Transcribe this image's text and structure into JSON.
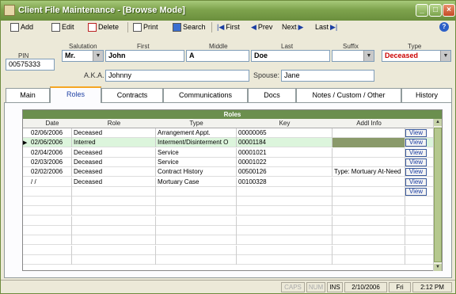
{
  "window": {
    "title": "Client File Maintenance - [Browse Mode]"
  },
  "toolbar": {
    "add": "Add",
    "edit": "Edit",
    "delete": "Delete",
    "print": "Print",
    "search": "Search",
    "first": "First",
    "prev": "Prev",
    "next": "Next",
    "last": "Last"
  },
  "client": {
    "pin_label": "PIN",
    "pin": "00575333",
    "salutation_label": "Salutation",
    "salutation": "Mr.",
    "first_label": "First",
    "first": "John",
    "middle_label": "Middle",
    "middle": "A",
    "last_label": "Last",
    "last": "Doe",
    "suffix_label": "Suffix",
    "suffix": "",
    "type_label": "Type",
    "type": "Deceased",
    "aka_label": "A.K.A.",
    "aka": "Johnny",
    "spouse_label": "Spouse:",
    "spouse": "Jane"
  },
  "tabs": [
    "Main",
    "Roles",
    "Contracts",
    "Communications",
    "Docs",
    "Notes / Custom / Other",
    "History"
  ],
  "roles": {
    "title": "Roles",
    "columns": [
      "Date",
      "Role",
      "Type",
      "Key",
      "Addl Info"
    ],
    "view_label": "View",
    "rows": [
      {
        "date": "02/06/2006",
        "role": "Deceased",
        "type": "Arrangement Appt.",
        "key": "00000065",
        "info": ""
      },
      {
        "date": "02/06/2006",
        "role": "Interred",
        "type": "Interment/Disinterment O",
        "key": "00001184",
        "info": ""
      },
      {
        "date": "02/04/2006",
        "role": "Deceased",
        "type": "Service",
        "key": "00001021",
        "info": ""
      },
      {
        "date": "02/03/2006",
        "role": "Deceased",
        "type": "Service",
        "key": "00001022",
        "info": ""
      },
      {
        "date": "02/02/2006",
        "role": "Deceased",
        "type": "Contract History",
        "key": "00500126",
        "info": "Type: Mortuary At-Need"
      },
      {
        "date": "/  /",
        "role": "Deceased",
        "type": "Mortuary Case",
        "key": "00100328",
        "info": ""
      }
    ]
  },
  "status": {
    "caps": "CAPS",
    "num": "NUM",
    "ins": "INS",
    "date": "2/10/2006",
    "day": "Fri",
    "time": "2:12 PM"
  },
  "colors": {
    "title_green": "#7ea34d",
    "type_red": "#cc0000",
    "grid_title": "#6b8f4e",
    "selected_row": "#dcf5dc",
    "active_tab_accent": "#f5a623"
  }
}
